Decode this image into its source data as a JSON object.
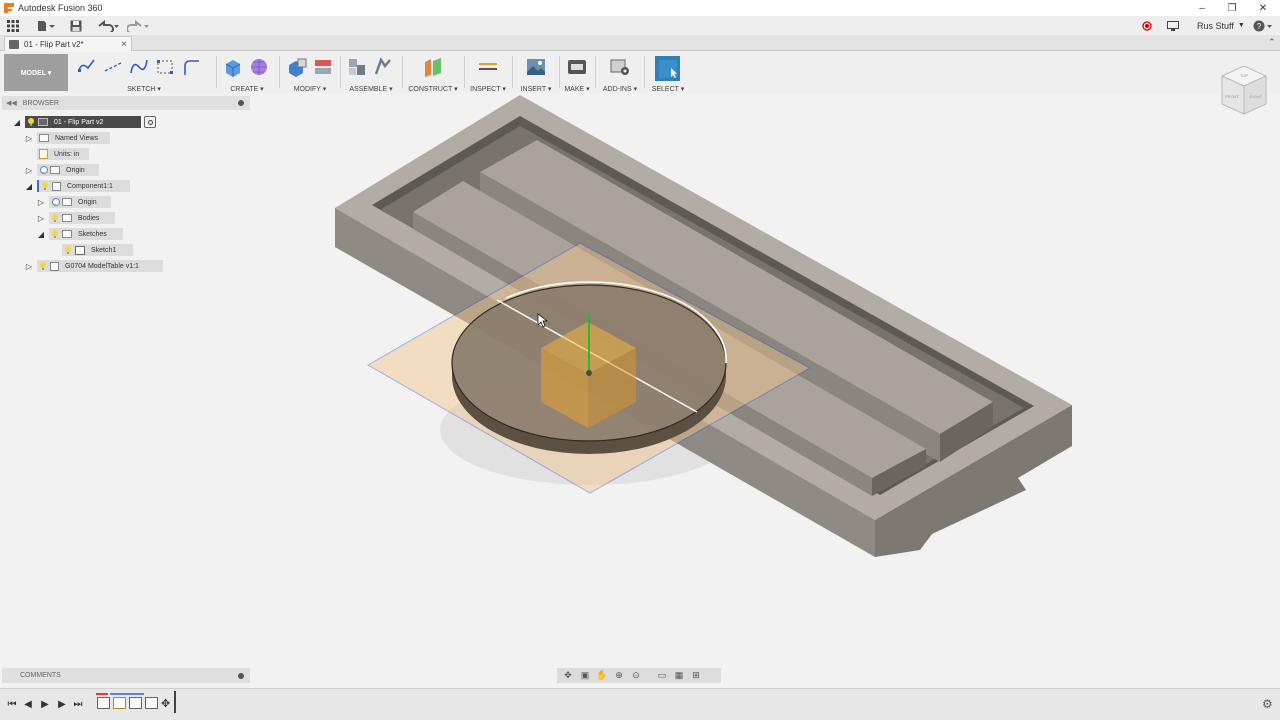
{
  "window": {
    "title": "Autodesk Fusion 360"
  },
  "quick_access": {
    "user_name": "Rus Stuff"
  },
  "document_tab": {
    "label": "01 - Flip Part v2*",
    "close": "×"
  },
  "toolbar": {
    "workspace": "MODEL ▾",
    "groups": [
      {
        "id": "sketch",
        "label": "SKETCH ▾"
      },
      {
        "id": "create",
        "label": "CREATE ▾"
      },
      {
        "id": "modify",
        "label": "MODIFY ▾"
      },
      {
        "id": "assemble",
        "label": "ASSEMBLE ▾"
      },
      {
        "id": "construct",
        "label": "CONSTRUCT ▾"
      },
      {
        "id": "inspect",
        "label": "INSPECT ▾"
      },
      {
        "id": "insert",
        "label": "INSERT ▾"
      },
      {
        "id": "make",
        "label": "MAKE ▾"
      },
      {
        "id": "addins",
        "label": "ADD-INS ▾"
      },
      {
        "id": "select",
        "label": "SELECT ▾"
      }
    ]
  },
  "browser": {
    "title": "BROWSER",
    "items": [
      {
        "label": "01 - Flip Part v2"
      },
      {
        "label": "Named Views"
      },
      {
        "label": "Units: in"
      },
      {
        "label": "Origin"
      },
      {
        "label": "Component1:1"
      },
      {
        "label": "Origin"
      },
      {
        "label": "Bodies"
      },
      {
        "label": "Sketches"
      },
      {
        "label": "Sketch1"
      },
      {
        "label": "G0704 ModelTable v1:1"
      }
    ]
  },
  "comments": {
    "title": "COMMENTS"
  },
  "viewcube": {
    "top": "TOP",
    "front": "FRONT",
    "right": "RIGHT"
  },
  "colors": {
    "accent": "#3a6fd8",
    "part": "#a8a29a",
    "sketch_plane": "#f3c48a",
    "root_pill": "#4a4a4a"
  }
}
